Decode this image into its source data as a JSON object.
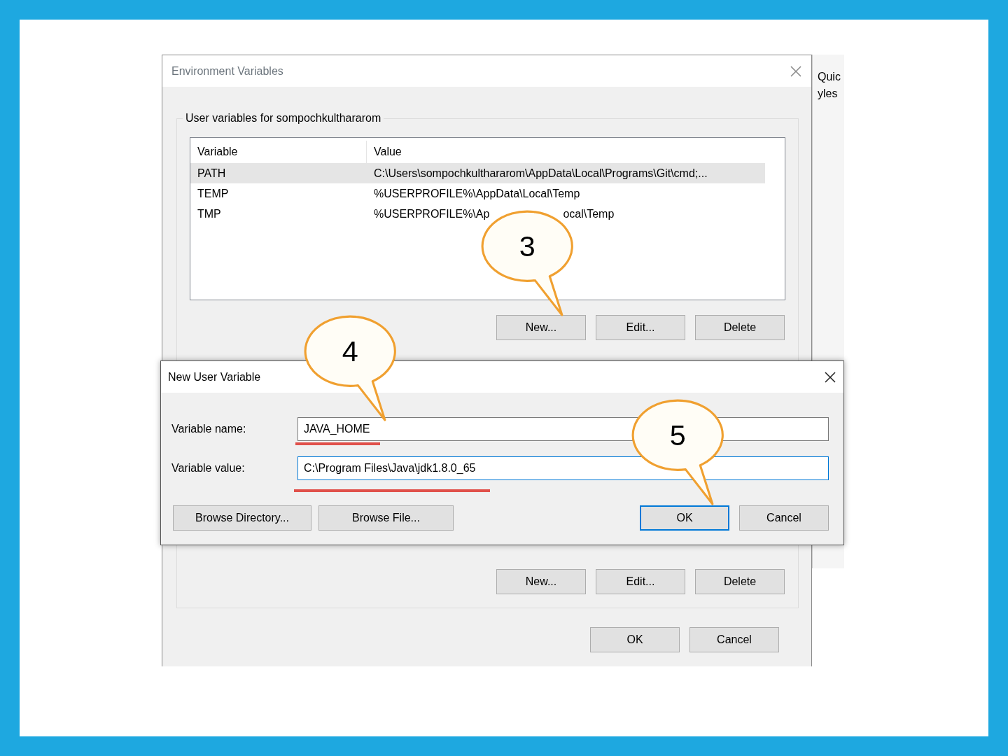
{
  "background_window": {
    "fragments": [
      "Quic",
      "yles"
    ]
  },
  "environment_dialog": {
    "title": "Environment Variables",
    "group_title": "User variables for sompochkulthararom",
    "columns": [
      "Variable",
      "Value"
    ],
    "rows": [
      {
        "variable": "PATH",
        "value": "C:\\Users\\sompochkulthararom\\AppData\\Local\\Programs\\Git\\cmd;...",
        "selected": true
      },
      {
        "variable": "TEMP",
        "value": "%USERPROFILE%\\AppData\\Local\\Temp",
        "selected": false
      },
      {
        "variable": "TMP",
        "value": "%USERPROFILE%\\Ap",
        "value_tail": "ocal\\Temp",
        "selected": false
      }
    ],
    "user_buttons": [
      "New...",
      "Edit...",
      "Delete"
    ],
    "system_buttons": [
      "New...",
      "Edit...",
      "Delete"
    ],
    "footer_buttons": [
      "OK",
      "Cancel"
    ]
  },
  "new_variable_dialog": {
    "title": "New User Variable",
    "fields": [
      {
        "label": "Variable name:",
        "value": "JAVA_HOME",
        "focused": false,
        "highlighted": true
      },
      {
        "label": "Variable value:",
        "value": "C:\\Program Files\\Java\\jdk1.8.0_65",
        "focused": true,
        "highlighted": true
      }
    ],
    "left_buttons": [
      "Browse Directory...",
      "Browse File..."
    ],
    "right_buttons": [
      {
        "label": "OK",
        "default": true
      },
      {
        "label": "Cancel",
        "default": false
      }
    ]
  },
  "annotations": [
    {
      "number": "3"
    },
    {
      "number": "4"
    },
    {
      "number": "5"
    }
  ]
}
